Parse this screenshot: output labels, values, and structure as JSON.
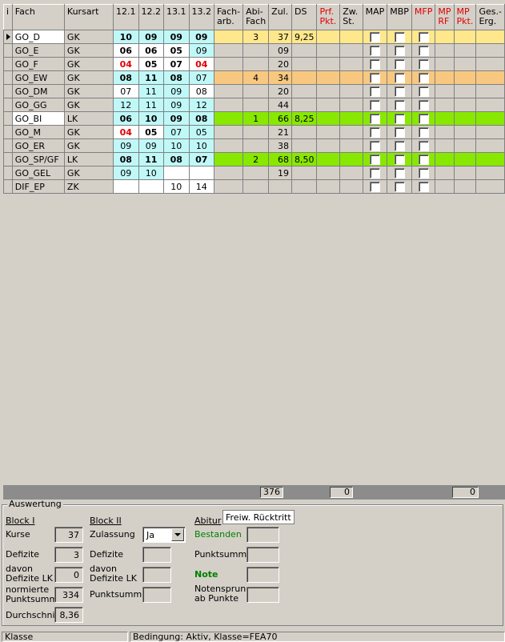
{
  "headers": {
    "info": "i",
    "fach": "Fach",
    "kursart": "Kursart",
    "q1": "12.1",
    "q2": "12.2",
    "q3": "13.1",
    "q4": "13.2",
    "facharb": "Fach-arb.",
    "abifach": "Abi-Fach",
    "zul": "Zul.",
    "ds": "DS",
    "prfpkt": "Prf. Pkt.",
    "zwst": "Zw. St.",
    "map": "MAP",
    "mbp": "MBP",
    "mfp": "MFP",
    "mprf": "MP RF",
    "mppkt": "MP Pkt.",
    "geserg": "Ges.-Erg."
  },
  "rows": [
    {
      "fach": "GO_D",
      "kurs": "GK",
      "g": [
        "10",
        "09",
        "09",
        "09"
      ],
      "facharb": "",
      "abi": "3",
      "zul": "37",
      "ds": "9,25"
    },
    {
      "fach": "GO_E",
      "kurs": "GK",
      "g": [
        "06",
        "06",
        "05",
        "09"
      ],
      "facharb": "",
      "abi": "",
      "zul": "09",
      "ds": ""
    },
    {
      "fach": "GO_F",
      "kurs": "GK",
      "g": [
        "04",
        "05",
        "07",
        "04"
      ],
      "facharb": "",
      "abi": "",
      "zul": "20",
      "ds": ""
    },
    {
      "fach": "GO_EW",
      "kurs": "GK",
      "g": [
        "08",
        "11",
        "08",
        "07"
      ],
      "facharb": "",
      "abi": "4",
      "zul": "34",
      "ds": ""
    },
    {
      "fach": "GO_DM",
      "kurs": "GK",
      "g": [
        "07",
        "11",
        "09",
        "08"
      ],
      "facharb": "",
      "abi": "",
      "zul": "20",
      "ds": ""
    },
    {
      "fach": "GO_GG",
      "kurs": "GK",
      "g": [
        "12",
        "11",
        "09",
        "12"
      ],
      "facharb": "",
      "abi": "",
      "zul": "44",
      "ds": ""
    },
    {
      "fach": "GO_BI",
      "kurs": "LK",
      "g": [
        "06",
        "10",
        "09",
        "08"
      ],
      "facharb": "",
      "abi": "1",
      "zul": "66",
      "ds": "8,25"
    },
    {
      "fach": "GO_M",
      "kurs": "GK",
      "g": [
        "04",
        "05",
        "07",
        "05"
      ],
      "facharb": "",
      "abi": "",
      "zul": "21",
      "ds": ""
    },
    {
      "fach": "GO_ER",
      "kurs": "GK",
      "g": [
        "09",
        "09",
        "10",
        "10"
      ],
      "facharb": "",
      "abi": "",
      "zul": "38",
      "ds": ""
    },
    {
      "fach": "GO_SP/GF",
      "kurs": "LK",
      "g": [
        "08",
        "11",
        "08",
        "07"
      ],
      "facharb": "",
      "abi": "2",
      "zul": "68",
      "ds": "8,50"
    },
    {
      "fach": "GO_GEL",
      "kurs": "GK",
      "g": [
        "09",
        "10",
        "",
        ""
      ],
      "facharb": "",
      "abi": "",
      "zul": "19",
      "ds": ""
    },
    {
      "fach": "DIF_EP",
      "kurs": "ZK",
      "g": [
        "",
        "",
        "10",
        "14"
      ],
      "facharb": "",
      "abi": "",
      "zul": "",
      "ds": ""
    }
  ],
  "totals": {
    "zul": "376",
    "zwst": "0",
    "geserg": "0"
  },
  "auswertung": {
    "title": "Auswertung",
    "block1": {
      "title": "Block I",
      "kurse_label": "Kurse",
      "kurse": "37",
      "defizite_label": "Defizite",
      "defizite": "3",
      "davon_label": "davon Defizite LK",
      "davon": "0",
      "norm_label": "normierte Punktsumme",
      "norm": "334",
      "schnitt_label": "Durchschnitt",
      "schnitt": "8,36"
    },
    "block2": {
      "title": "Block II",
      "zul_label": "Zulassung",
      "zul_value": "Ja",
      "defizite_label": "Defizite",
      "davon_label": "davon Defizite LK",
      "punkt_label": "Punktsumme"
    },
    "abitur": {
      "title": "Abitur",
      "bestanden": "Bestanden",
      "punkt_label": "Punktsumme",
      "note_label": "Note",
      "noten_label": "Notensprung ab Punkte"
    },
    "tooltip": "Freiw. Rücktritt"
  },
  "status": {
    "left": "Klasse",
    "right": "Bedingung: Aktiv, Klasse=FEA70"
  },
  "colors": {
    "yellow": "#ffe88c",
    "orange": "#f8c880",
    "green": "#88e800",
    "grade_bg": "#c0f8f8",
    "deficit": "#e00000"
  }
}
